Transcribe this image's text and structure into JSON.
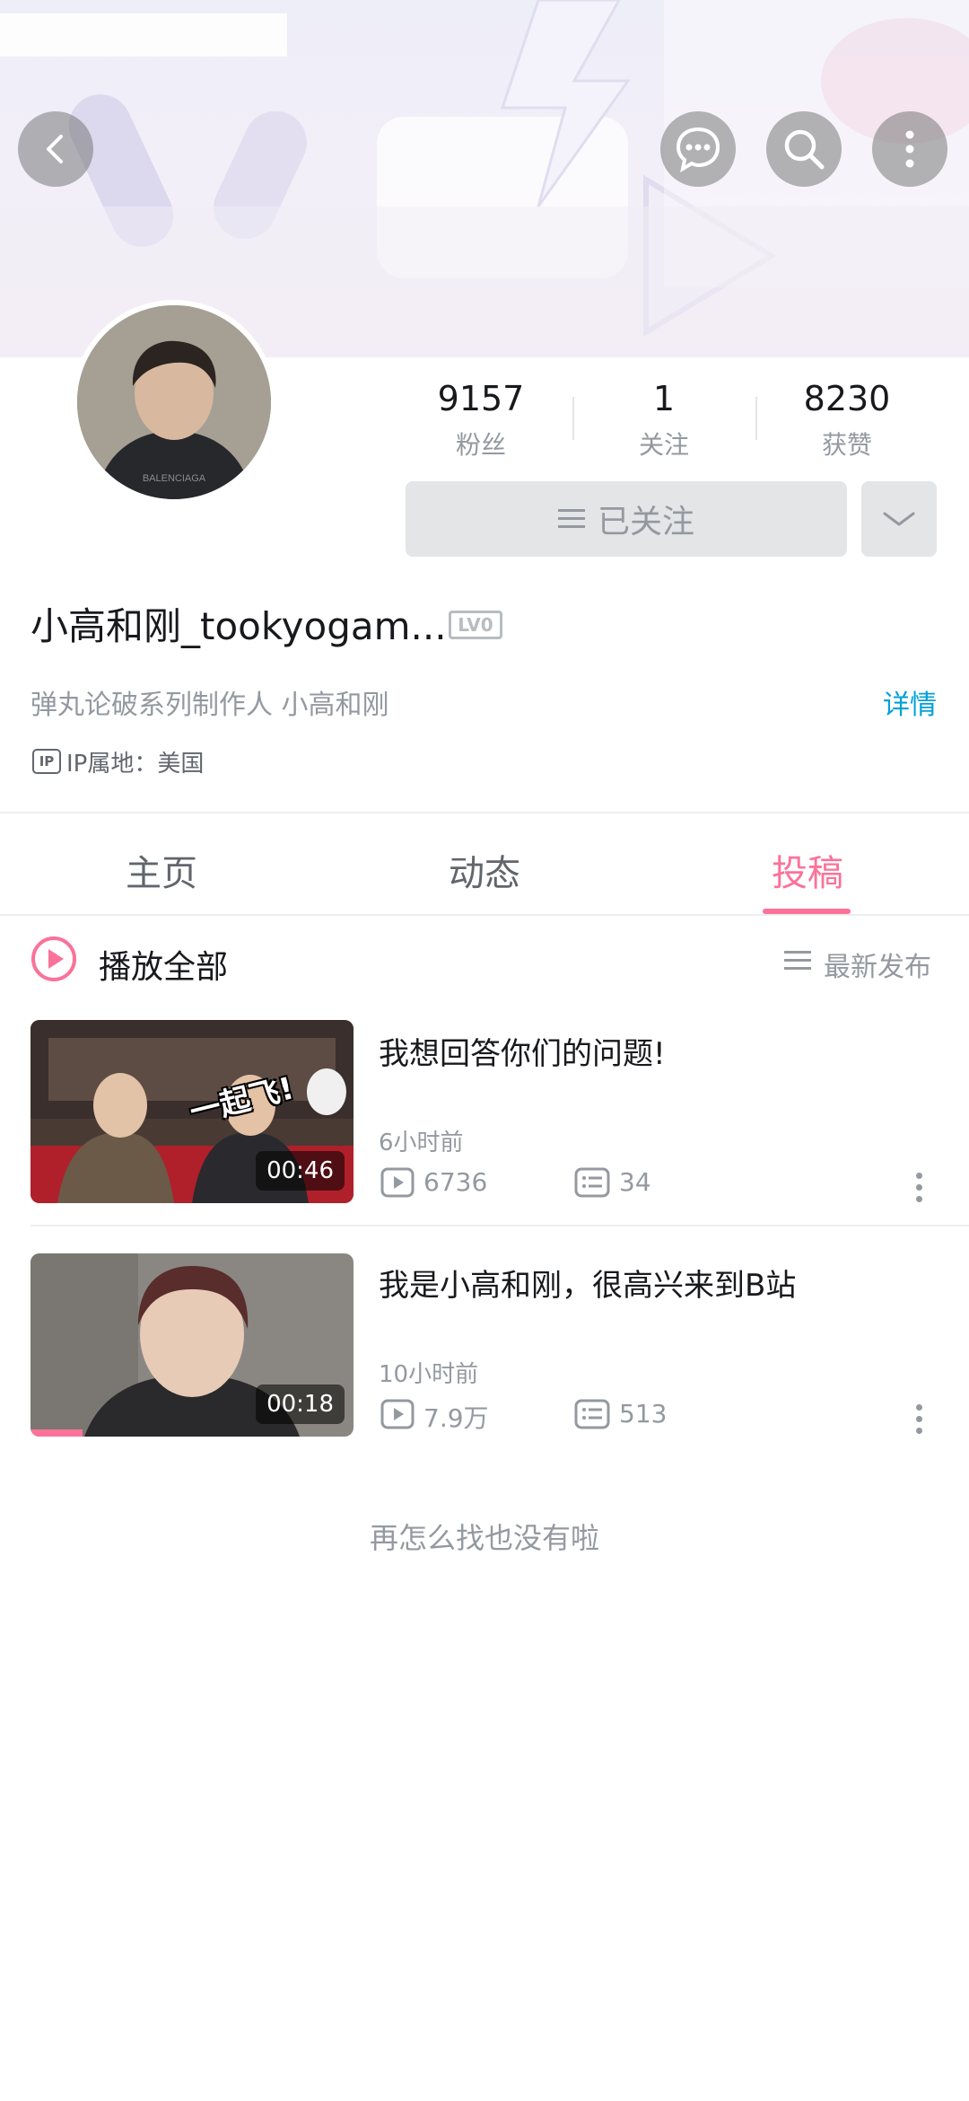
{
  "header": {
    "back_icon": "chevron-left-icon",
    "message_icon": "chat-bubble-icon",
    "search_icon": "search-icon",
    "more_icon": "vertical-dots-icon"
  },
  "profile": {
    "stats": [
      {
        "value": "9157",
        "label": "粉丝"
      },
      {
        "value": "1",
        "label": "关注"
      },
      {
        "value": "8230",
        "label": "获赞"
      }
    ],
    "follow_button": "已关注",
    "username": "小高和刚_tookyogam...",
    "level": "LV0",
    "bio": "弹丸论破系列制作人 小高和刚",
    "detail_link": "详情",
    "ip_badge": "IP",
    "ip_location": "IP属地：美国"
  },
  "tabs": [
    {
      "label": "主页"
    },
    {
      "label": "动态"
    },
    {
      "label": "投稿"
    }
  ],
  "active_tab_color": "#fb7299",
  "list_header": {
    "play_all": "播放全部",
    "sort": "最新发布"
  },
  "videos": [
    {
      "title": "我想回答你们的问题!",
      "thumb_text": "一起飞!",
      "duration": "00:46",
      "time": "6小时前",
      "views": "6736",
      "comments": "34"
    },
    {
      "title": "我是小高和刚，很高兴来到B站",
      "duration": "00:18",
      "time": "10小时前",
      "views": "7.9万",
      "comments": "513",
      "watch_progress": 0.16
    }
  ],
  "end_message": "再怎么找也没有啦"
}
